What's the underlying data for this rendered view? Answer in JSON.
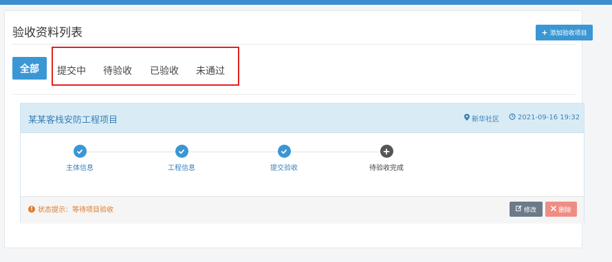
{
  "panel": {
    "title": "验收资料列表",
    "add_button": "添加验收项目"
  },
  "tabs": [
    "全部",
    "提交中",
    "待验收",
    "已验收",
    "未通过"
  ],
  "colors": {
    "accent": "#3a97d4",
    "highlight_border": "#e02020",
    "status_text": "#e07b2a"
  },
  "card": {
    "title": "某某客栈安防工程项目",
    "location": "新华社区",
    "datetime": "2021-09-16 19:32",
    "steps": [
      {
        "label": "主体信息",
        "state": "done",
        "icon": "check-icon"
      },
      {
        "label": "工程信息",
        "state": "done",
        "icon": "check-icon"
      },
      {
        "label": "提交验收",
        "state": "done",
        "icon": "check-icon"
      },
      {
        "label": "待验收完成",
        "state": "pending",
        "icon": "plus-icon"
      }
    ],
    "status_text": "状态提示：等待项目验收",
    "edit_button": "修改",
    "delete_button": "删除"
  }
}
